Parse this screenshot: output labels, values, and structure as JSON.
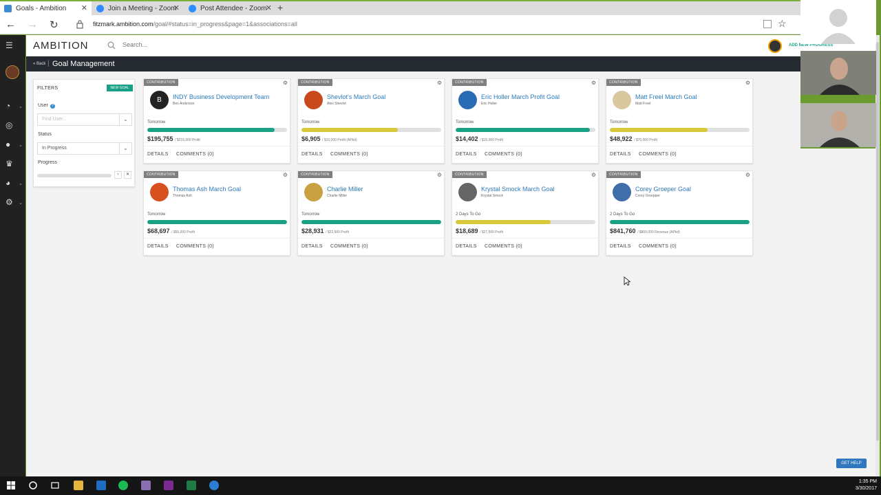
{
  "browser": {
    "tabs": [
      {
        "label": "Goals - Ambition",
        "active": true,
        "color": "#3c8ed0"
      },
      {
        "label": "Join a Meeting - Zoom",
        "active": false,
        "color": "#2d8cff"
      },
      {
        "label": "Post Attendee - Zoom",
        "active": false,
        "color": "#2d8cff"
      }
    ],
    "url_domain": "fitzmark.ambition.com",
    "url_path": "/goal/#status=in_progress&page=1&associations=all"
  },
  "header": {
    "logo": "AMBITION",
    "search_placeholder": "Search...",
    "add_progress": "ADD NEW PROGRESS"
  },
  "subheader": {
    "back": "« Back",
    "title": "Goal Management"
  },
  "filters": {
    "title": "FILTERS",
    "new_goal": "NEW GOAL",
    "user_label": "User",
    "user_placeholder": "Find User...",
    "status_label": "Status",
    "status_value": "In Progress",
    "progress_label": "Progress"
  },
  "cards": [
    {
      "tag": "CONTRIBUTION",
      "title": "INDY Business Development Team",
      "owner": "Ben Anderson",
      "avatar_letter": "B",
      "avatar_color": "#222222",
      "due": "Tomorrow",
      "value": "$195,755",
      "target": "/ $215,000 Profit",
      "progress": 0.91,
      "bar_color": "#18a185"
    },
    {
      "tag": "CONTRIBUTION",
      "title": "Shevlot's March Goal",
      "owner": "Alex Shevlot",
      "avatar_letter": "",
      "avatar_color": "#c84a1c",
      "due": "Tomorrow",
      "value": "$6,905",
      "target": "/ $10,000 Profit (APkd)",
      "progress": 0.69,
      "bar_color": "#d7c93a"
    },
    {
      "tag": "CONTRIBUTION",
      "title": "Eric Holler March Profit Goal",
      "owner": "Eric Holler",
      "avatar_letter": "",
      "avatar_color": "#2a6cb4",
      "due": "Tomorrow",
      "value": "$14,402",
      "target": "/ $15,000 Profit",
      "progress": 0.96,
      "bar_color": "#18a185"
    },
    {
      "tag": "CONTRIBUTION",
      "title": "Matt Freel March Goal",
      "owner": "Matt Freel",
      "avatar_letter": "",
      "avatar_color": "#d9c7a0",
      "due": "Tomorrow",
      "value": "$48,922",
      "target": "/ $70,000 Profit",
      "progress": 0.7,
      "bar_color": "#d7c93a"
    },
    {
      "tag": "CONTRIBUTION",
      "title": "Thomas Ash March Goal",
      "owner": "Thomas Ash",
      "avatar_letter": "",
      "avatar_color": "#d8501f",
      "due": "Tomorrow",
      "value": "$68,697",
      "target": "/ $55,000 Profit",
      "progress": 1.0,
      "bar_color": "#18a185"
    },
    {
      "tag": "CONTRIBUTION",
      "title": "Charlie Miller",
      "owner": "Charlie Miller",
      "avatar_letter": "",
      "avatar_color": "#c9a042",
      "due": "Tomorrow",
      "value": "$28,931",
      "target": "/ $22,500 Profit",
      "progress": 1.0,
      "bar_color": "#18a185"
    },
    {
      "tag": "CONTRIBUTION",
      "title": "Krystal Smock March Goal",
      "owner": "Krystal Smock",
      "avatar_letter": "",
      "avatar_color": "#666666",
      "due": "2 Days To Go",
      "value": "$18,689",
      "target": "/ $27,500 Profit",
      "progress": 0.68,
      "bar_color": "#d7c93a"
    },
    {
      "tag": "CONTRIBUTION",
      "title": "Corey Groeper Goal",
      "owner": "Corey Groepper",
      "avatar_letter": "",
      "avatar_color": "#3f6ea8",
      "due": "2 Days To Go",
      "value": "$841,760",
      "target": "/ $800,000 Revenue (APkd)",
      "progress": 1.0,
      "bar_color": "#18a185"
    }
  ],
  "card_actions": {
    "details": "DETAILS",
    "comments": "COMMENTS (0)"
  },
  "get_help": "GET HELP",
  "clock": {
    "time": "1:35 PM",
    "date": "3/30/2017"
  }
}
